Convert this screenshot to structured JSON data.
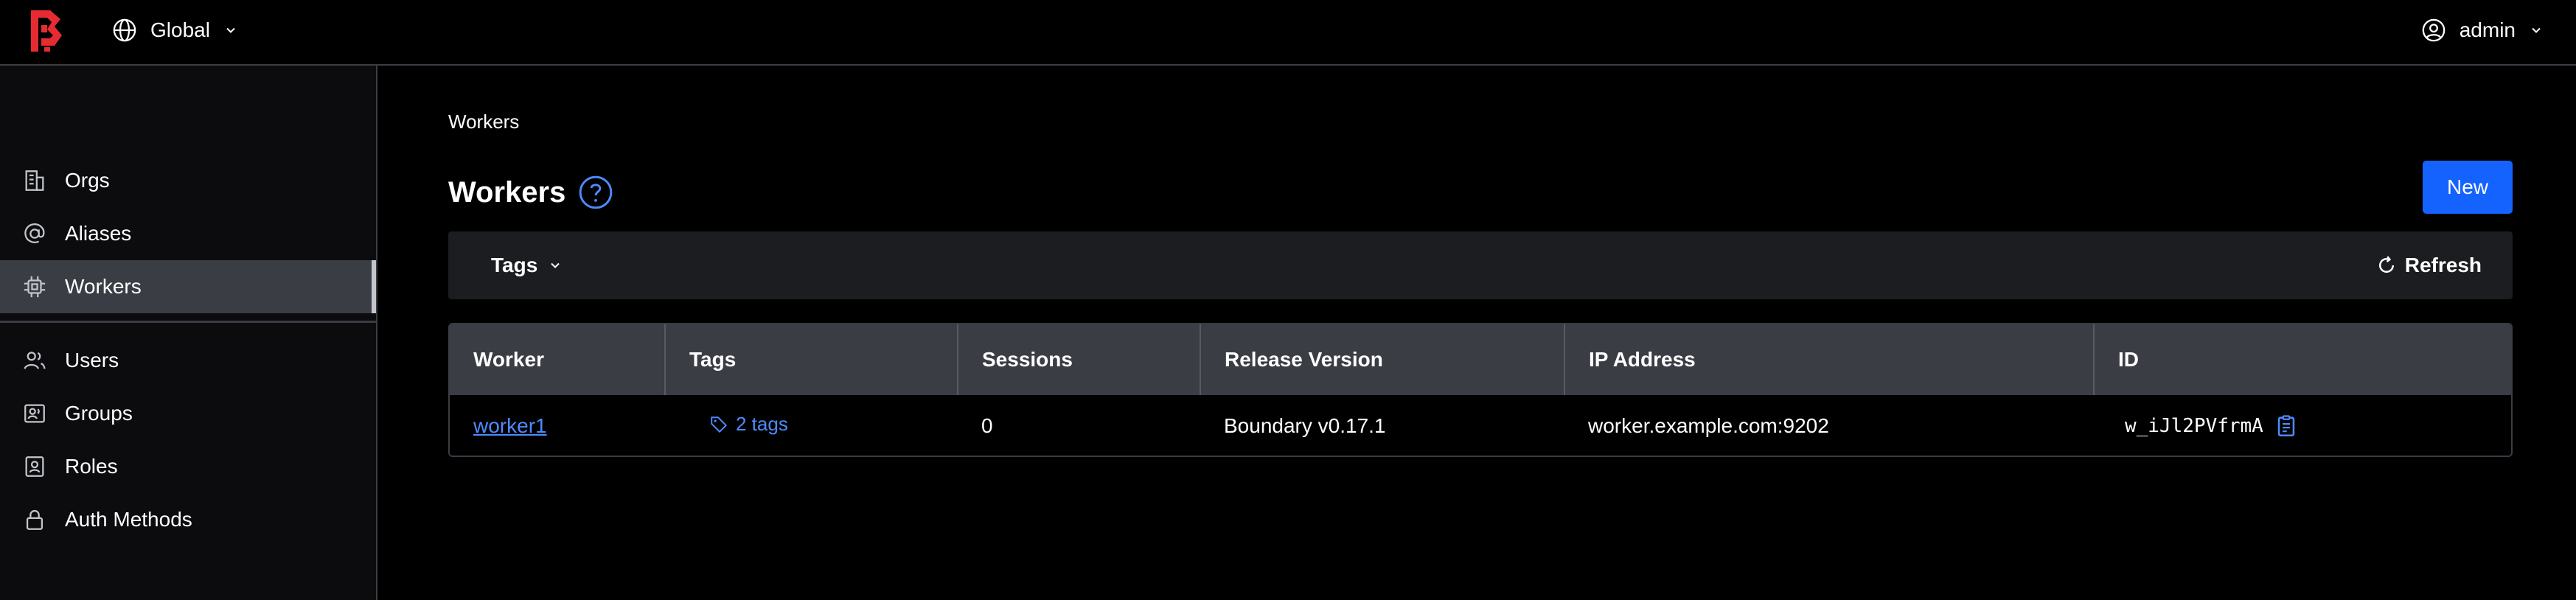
{
  "app": {
    "logo_icon": "boundary-logo",
    "accent_color": "#e62b33"
  },
  "header": {
    "scope_icon": "globe-icon",
    "scope_label": "Global",
    "user_icon": "user-circle-icon",
    "user_label": "admin"
  },
  "sidebar": {
    "items": [
      {
        "label": "Orgs",
        "icon": "building-icon"
      },
      {
        "label": "Aliases",
        "icon": "at-sign-icon"
      },
      {
        "label": "Workers",
        "icon": "cpu-icon",
        "active": true
      },
      {
        "label": "Users",
        "icon": "users-icon"
      },
      {
        "label": "Groups",
        "icon": "groups-icon"
      },
      {
        "label": "Roles",
        "icon": "id-card-icon"
      },
      {
        "label": "Auth Methods",
        "icon": "lock-icon"
      }
    ]
  },
  "main": {
    "breadcrumb": "Workers",
    "title": "Workers",
    "new_label": "New",
    "primary_color": "#1563ff",
    "filters": {
      "tags_label": "Tags",
      "refresh_label": "Refresh"
    },
    "table": {
      "columns": [
        "Worker",
        "Tags",
        "Sessions",
        "Release Version",
        "IP Address",
        "ID"
      ],
      "rows": [
        {
          "worker": "worker1",
          "tags": "2 tags",
          "sessions": "0",
          "release_version": "Boundary v0.17.1",
          "ip_address": "worker.example.com:9202",
          "id": "w_iJl2PVfrmA"
        }
      ]
    }
  }
}
